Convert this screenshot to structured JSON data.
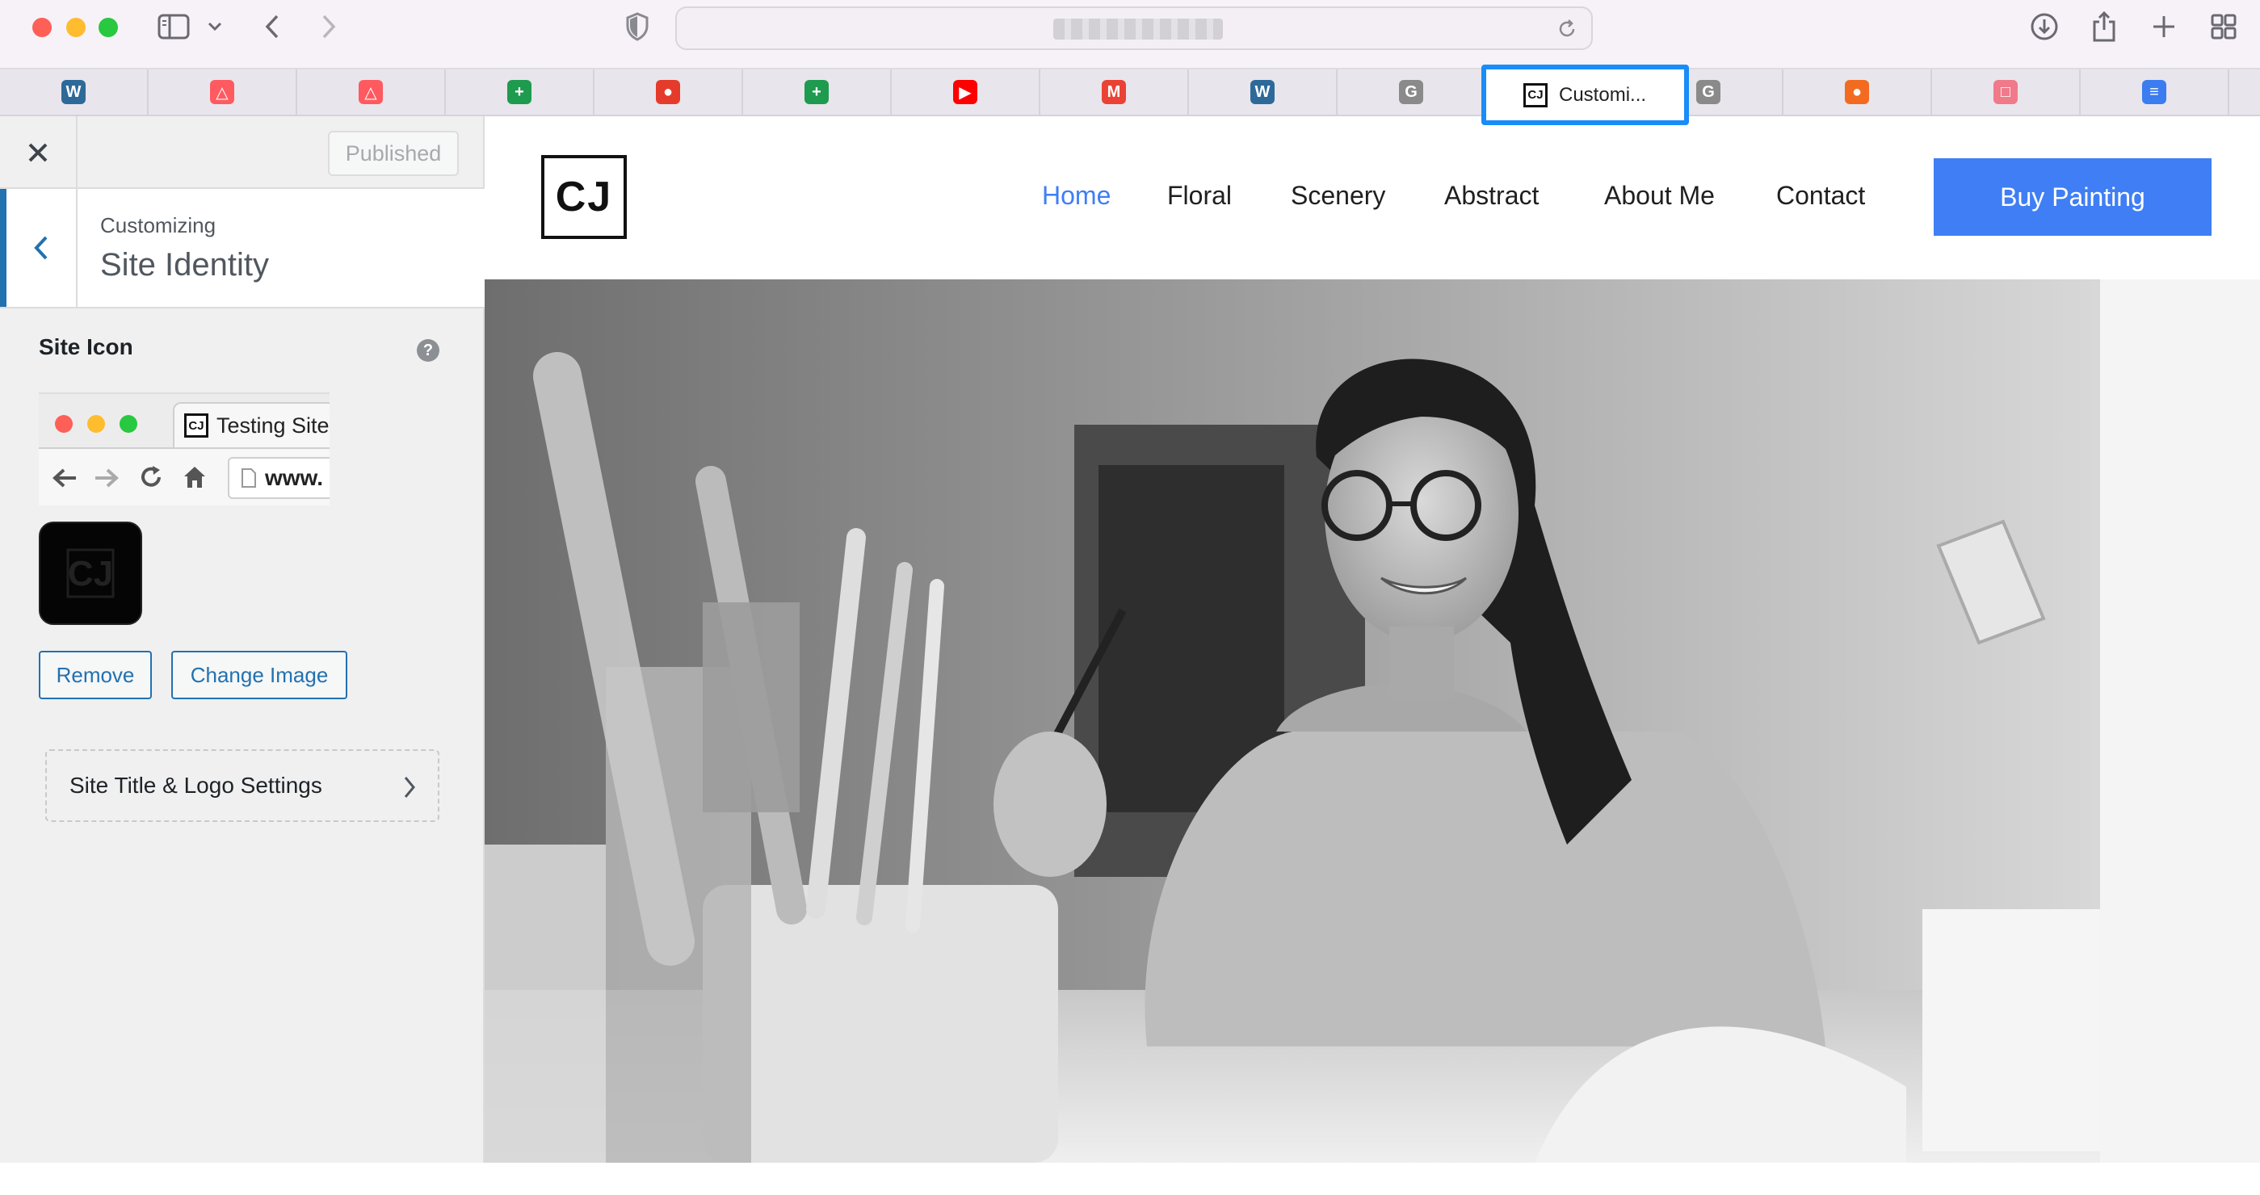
{
  "toolbar": {
    "url_obscured": "••••••••••••"
  },
  "tabs": [
    {
      "icon": "wordpress-icon",
      "color": "#2d6a99",
      "glyph": "W"
    },
    {
      "icon": "airbnb-icon",
      "color": "#ff5a5f",
      "glyph": "△"
    },
    {
      "icon": "airbnb-icon",
      "color": "#ff5a5f",
      "glyph": "△"
    },
    {
      "icon": "google-sheets-icon",
      "color": "#1e9b4e",
      "glyph": "+"
    },
    {
      "icon": "rooster-icon",
      "color": "#e53b2b",
      "glyph": "●"
    },
    {
      "icon": "google-sheets-icon",
      "color": "#1e9b4e",
      "glyph": "+"
    },
    {
      "icon": "youtube-icon",
      "color": "#ff0000",
      "glyph": "▶"
    },
    {
      "icon": "gmail-icon",
      "color": "#ea4335",
      "glyph": "M"
    },
    {
      "icon": "wordpress-icon",
      "color": "#2d6a99",
      "glyph": "W"
    },
    {
      "icon": "grammarly-g-icon",
      "color": "#8a8a8a",
      "glyph": "G"
    },
    {
      "icon": "grammarly-g-icon",
      "color": "#8a8a8a",
      "glyph": "G"
    },
    {
      "icon": "orange-app-icon",
      "color": "#f26b21",
      "glyph": "●"
    },
    {
      "icon": "analytics-icon",
      "color": "#f07a8a",
      "glyph": "□"
    },
    {
      "icon": "google-docs-icon",
      "color": "#3b7cf0",
      "glyph": "≡"
    }
  ],
  "active_tab": {
    "title": "Customi...",
    "favicon_text": "CJ"
  },
  "panel": {
    "published_label": "Published",
    "customizing_label": "Customizing",
    "section_title": "Site Identity",
    "site_icon_label": "Site Icon",
    "help_glyph": "?",
    "preview_tab_title": "Testing Site",
    "preview_url": "www.",
    "remove_label": "Remove",
    "change_image_label": "Change Image",
    "logo_settings_label": "Site Title & Logo Settings"
  },
  "site": {
    "logo_text": "CJ",
    "nav": [
      "Home",
      "Floral",
      "Scenery",
      "Abstract",
      "About Me",
      "Contact"
    ],
    "active_nav_color": "#3f7ef5",
    "cta_label": "Buy Painting"
  }
}
